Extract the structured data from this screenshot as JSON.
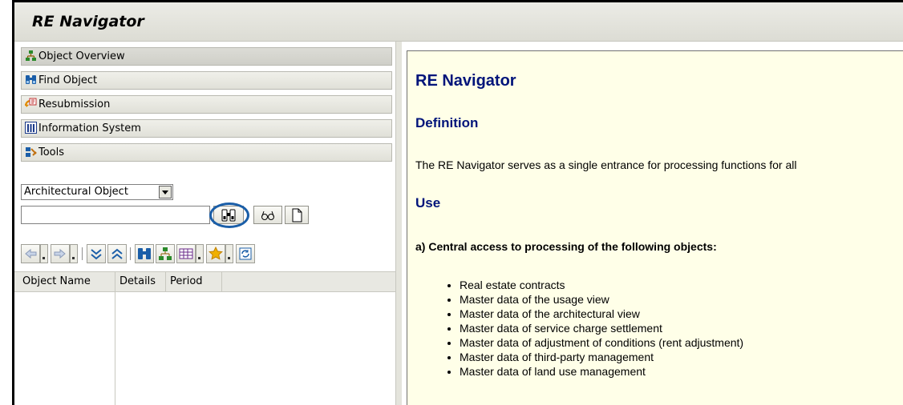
{
  "app": {
    "title": "RE Navigator"
  },
  "nav": {
    "items": [
      {
        "label": "Object Overview",
        "icon": "hierarchy-icon"
      },
      {
        "label": "Find Object",
        "icon": "binoculars-icon"
      },
      {
        "label": "Resubmission",
        "icon": "resubmission-icon"
      },
      {
        "label": "Information System",
        "icon": "report-icon"
      },
      {
        "label": "Tools",
        "icon": "tools-icon"
      }
    ]
  },
  "search": {
    "object_type": "Architectural Object",
    "input_value": ""
  },
  "table": {
    "headers": [
      "Object Name",
      "Details",
      "Period"
    ]
  },
  "doc": {
    "title": "RE Navigator",
    "definition_heading": "Definition",
    "definition_text": "The RE Navigator serves as a single entrance for processing functions for all",
    "use_heading": "Use",
    "use_subheading": "a) Central access to processing of the following objects:",
    "items": [
      "Real estate contracts",
      "Master data of the usage view",
      "Master data of the architectural view",
      "Master data of service charge settlement",
      "Master data of adjustment of conditions (rent adjustment)",
      "Master data of third-party management",
      "Master data of land use management"
    ]
  },
  "colors": {
    "heading": "#00147a",
    "doc_background": "#ffffe8",
    "highlight_circle": "#1a5ea8"
  }
}
